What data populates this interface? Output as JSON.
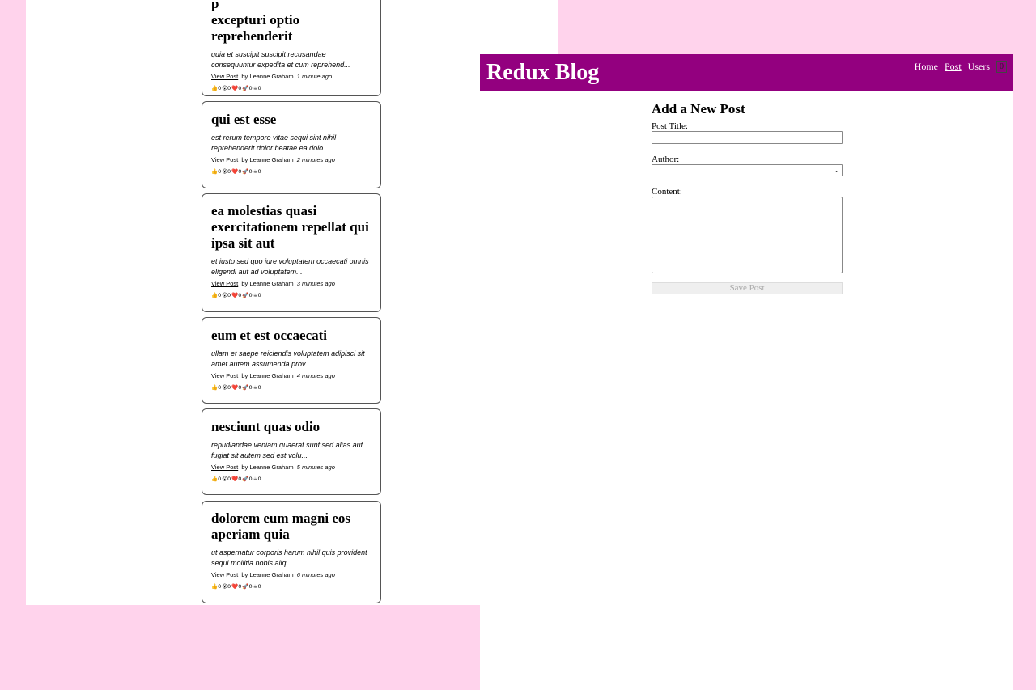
{
  "posts": [
    {
      "title_line1": "p",
      "title_line2": "excepturi optio",
      "title_line3": "reprehenderit",
      "excerpt": "quia et suscipit suscipit recusandae consequuntur expedita et cum reprehend...",
      "view_label": "View Post",
      "author": "by Leanne Graham",
      "time": "1 minute ago"
    },
    {
      "title": "qui est esse",
      "excerpt": "est rerum tempore vitae sequi sint nihil reprehenderit dolor beatae ea dolo...",
      "view_label": "View Post",
      "author": "by Leanne Graham",
      "time": "2 minutes ago"
    },
    {
      "title": "ea molestias quasi exercitationem repellat qui ipsa sit aut",
      "excerpt": "et iusto sed quo iure voluptatem occaecati omnis eligendi aut ad voluptatem...",
      "view_label": "View Post",
      "author": "by Leanne Graham",
      "time": "3 minutes ago"
    },
    {
      "title": "eum et est occaecati",
      "excerpt": "ullam et saepe reiciendis voluptatem adipisci sit amet autem assumenda prov...",
      "view_label": "View Post",
      "author": "by Leanne Graham",
      "time": "4 minutes ago"
    },
    {
      "title": "nesciunt quas odio",
      "excerpt": "repudiandae veniam quaerat sunt sed alias aut fugiat sit autem sed est volu...",
      "view_label": "View Post",
      "author": "by Leanne Graham",
      "time": "5 minutes ago"
    },
    {
      "title": "dolorem eum magni eos aperiam quia",
      "excerpt": "ut aspernatur corporis harum nihil quis provident sequi mollitia nobis aliq...",
      "view_label": "View Post",
      "author": "by Leanne Graham",
      "time": "6 minutes ago"
    }
  ],
  "reactions": [
    {
      "emoji": "👍",
      "icon": "thumbs-up-icon",
      "count": "0"
    },
    {
      "emoji": "😮",
      "icon": "wow-icon",
      "count": "0"
    },
    {
      "emoji": "❤️",
      "icon": "heart-icon",
      "count": "0"
    },
    {
      "emoji": "🚀",
      "icon": "rocket-icon",
      "count": "0"
    },
    {
      "emoji": "☕",
      "icon": "coffee-icon",
      "count": "0"
    }
  ],
  "header": {
    "title": "Redux Blog",
    "nav": [
      "Home",
      "Post",
      "Users"
    ],
    "active_nav": "Post",
    "badge": "0",
    "color": "#93007f"
  },
  "form": {
    "heading": "Add a New Post",
    "title_label": "Post Title:",
    "title_value": "",
    "author_label": "Author:",
    "author_selected": "",
    "content_label": "Content:",
    "content_value": "",
    "save_label": "Save Post",
    "save_disabled": true
  },
  "colors": {
    "desktop_bg": "#ffd3ec",
    "header_bg": "#93007f"
  }
}
